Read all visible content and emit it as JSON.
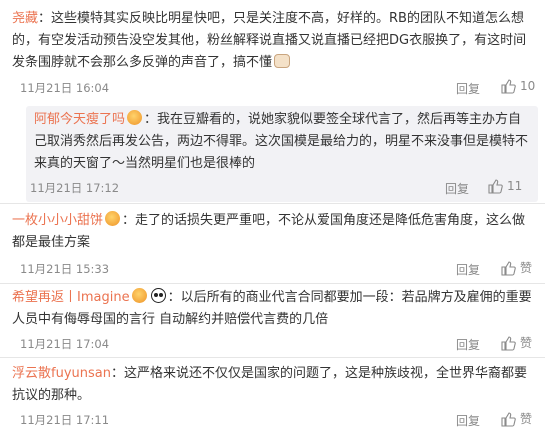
{
  "comments": [
    {
      "user": "尧藏",
      "text": "：这些模特其实反映比明星快吧，只是关注度不高，好样的。RB的团队不知道怎么想的，有空发活动预告没空发其他，粉丝解释说直播又说直播已经把DG衣服换了，有这时间发条围脖就不会那么多反弹的声音了，搞不懂",
      "time": "11月21日 16:04",
      "reply": "回复",
      "likes": "10"
    },
    {
      "user": "阿郁今天瘦了吗",
      "text": "：我在豆瓣看的，说她家貌似要签全球代言了，然后再等主办方自己取消秀然后再发公告，两边不得罪。这次国模是最给力的，明星不来没事但是模特不来真的天窗了～当然明星们也是很棒的",
      "time": "11月21日 17:12",
      "reply": "回复",
      "likes": "11"
    },
    {
      "user": "一枚小小小甜饼",
      "text": "：走了的话损失更严重吧，不论从爱国角度还是降低危害角度，这么做都是最佳方案",
      "time": "11月21日 15:33",
      "reply": "回复",
      "likes": "赞"
    },
    {
      "user": "希望再返丨Imagine",
      "text": "：以后所有的商业代言合同都要加一段：若品牌方及雇佣的重要人员中有侮辱母国的言行 自动解约并赔偿代言费的几倍",
      "time": "11月21日 17:04",
      "reply": "回复",
      "likes": "赞"
    },
    {
      "user": "浮云散fuyunsan",
      "text": "：这严格来说还不仅仅是国家的问题了，这是种族歧视，全世界华裔都要抗议的那种。",
      "time": "11月21日 17:11",
      "reply": "回复",
      "likes": "赞"
    }
  ],
  "colors": {
    "username": "#eb7350",
    "meta": "#8a8a8a",
    "quote_bg": "#f2f2f5"
  },
  "icons": [
    "thumbs-up-icon",
    "emoji-icon",
    "panda-icon",
    "cat-icon"
  ]
}
